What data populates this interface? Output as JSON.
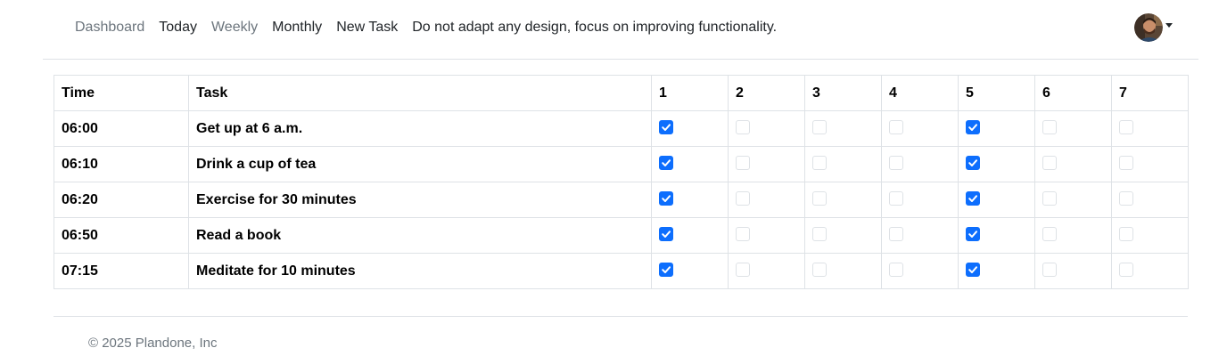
{
  "nav": {
    "links": [
      "Dashboard",
      "Today",
      "Weekly",
      "Monthly",
      "New Task"
    ],
    "note": "Do not adapt any design, focus on improving functionality."
  },
  "user": {
    "avatar_icon": "user-avatar",
    "menu_icon": "caret-down-icon"
  },
  "table": {
    "headers": [
      "Time",
      "Task",
      "1",
      "2",
      "3",
      "4",
      "5",
      "6",
      "7"
    ],
    "rows": [
      {
        "time": "06:00",
        "task": "Get up at 6 a.m.",
        "days": [
          true,
          false,
          false,
          false,
          true,
          false,
          false
        ]
      },
      {
        "time": "06:10",
        "task": "Drink a cup of tea",
        "days": [
          true,
          false,
          false,
          false,
          true,
          false,
          false
        ]
      },
      {
        "time": "06:20",
        "task": "Exercise for 30 minutes",
        "days": [
          true,
          false,
          false,
          false,
          true,
          false,
          false
        ]
      },
      {
        "time": "06:50",
        "task": "Read a book",
        "days": [
          true,
          false,
          false,
          false,
          true,
          false,
          false
        ]
      },
      {
        "time": "07:15",
        "task": "Meditate for 10 minutes",
        "days": [
          true,
          false,
          false,
          false,
          true,
          false,
          false
        ]
      }
    ]
  },
  "footer": {
    "copyright": "© 2025 Plandone, Inc"
  },
  "colors": {
    "accent": "#0d6efd",
    "border": "#dee2e6",
    "muted": "#6c757d"
  }
}
